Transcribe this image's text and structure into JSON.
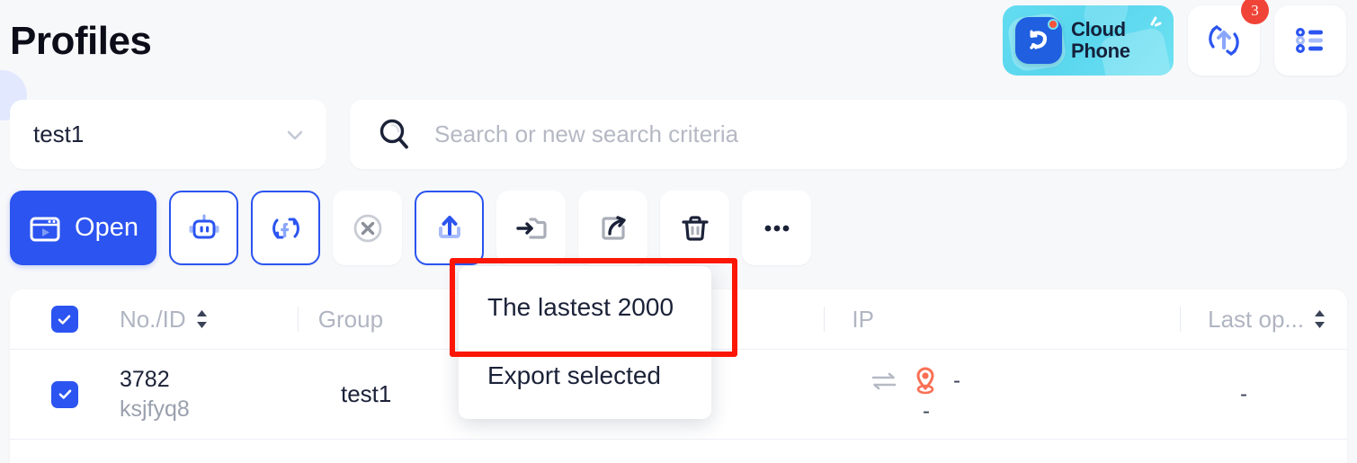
{
  "header": {
    "title": "Profiles",
    "cloud_phone": {
      "line1": "Cloud",
      "line2": "Phone",
      "icon": "cloud-phone-logo-icon"
    },
    "sync_button": {
      "icon": "sync-upload-icon",
      "badge": "3"
    },
    "list_button": {
      "icon": "list-view-icon"
    }
  },
  "filters": {
    "group": {
      "value": "test1",
      "chevron": "chevron-down-icon"
    },
    "search": {
      "placeholder": "Search or new search criteria",
      "icon": "search-icon",
      "value": ""
    }
  },
  "toolbar": {
    "open_label": "Open",
    "buttons": [
      {
        "name": "open-button",
        "icon": "browser-play-icon",
        "label": "Open"
      },
      {
        "name": "automation-button",
        "icon": "robot-icon",
        "label": ""
      },
      {
        "name": "facebook-sync-button",
        "icon": "facebook-sync-icon",
        "label": ""
      },
      {
        "name": "close-button",
        "icon": "close-circle-icon",
        "label": ""
      },
      {
        "name": "export-button",
        "icon": "upload-export-icon",
        "label": ""
      },
      {
        "name": "move-to-group-button",
        "icon": "folder-arrow-icon",
        "label": ""
      },
      {
        "name": "share-button",
        "icon": "share-arrow-icon",
        "label": ""
      },
      {
        "name": "delete-button",
        "icon": "trash-icon",
        "label": ""
      },
      {
        "name": "more-button",
        "icon": "ellipsis-icon",
        "label": ""
      }
    ]
  },
  "dropdown": {
    "items": [
      {
        "label": "The lastest 2000",
        "highlighted": true
      },
      {
        "label": "Export selected",
        "highlighted": false
      }
    ],
    "highlight_color": "#fc1605"
  },
  "table": {
    "header": {
      "select_all_checked": true,
      "columns": [
        {
          "label": "No./ID",
          "sortable": true
        },
        {
          "label": "Group",
          "sortable": false
        },
        {
          "label": "IP",
          "sortable": false
        },
        {
          "label": "Last op...",
          "sortable": true
        }
      ]
    },
    "rows": [
      {
        "checked": true,
        "id_number": "3782",
        "id_code": "ksjfyq8",
        "group": "test1",
        "ip_proxy_icon": "proxy-transfer-icon",
        "ip_location_icon": "location-pin-icon",
        "ip_value": "-",
        "ip_secondary": "-",
        "last_op": "-"
      }
    ]
  },
  "colors": {
    "primary_blue": "#2b54f0",
    "badge_red": "#f04438",
    "highlight_red": "#fc1605",
    "cloud_cyan": "#63dcf0",
    "pin_orange": "#fa7055",
    "page_bg": "#f7f8fa"
  }
}
